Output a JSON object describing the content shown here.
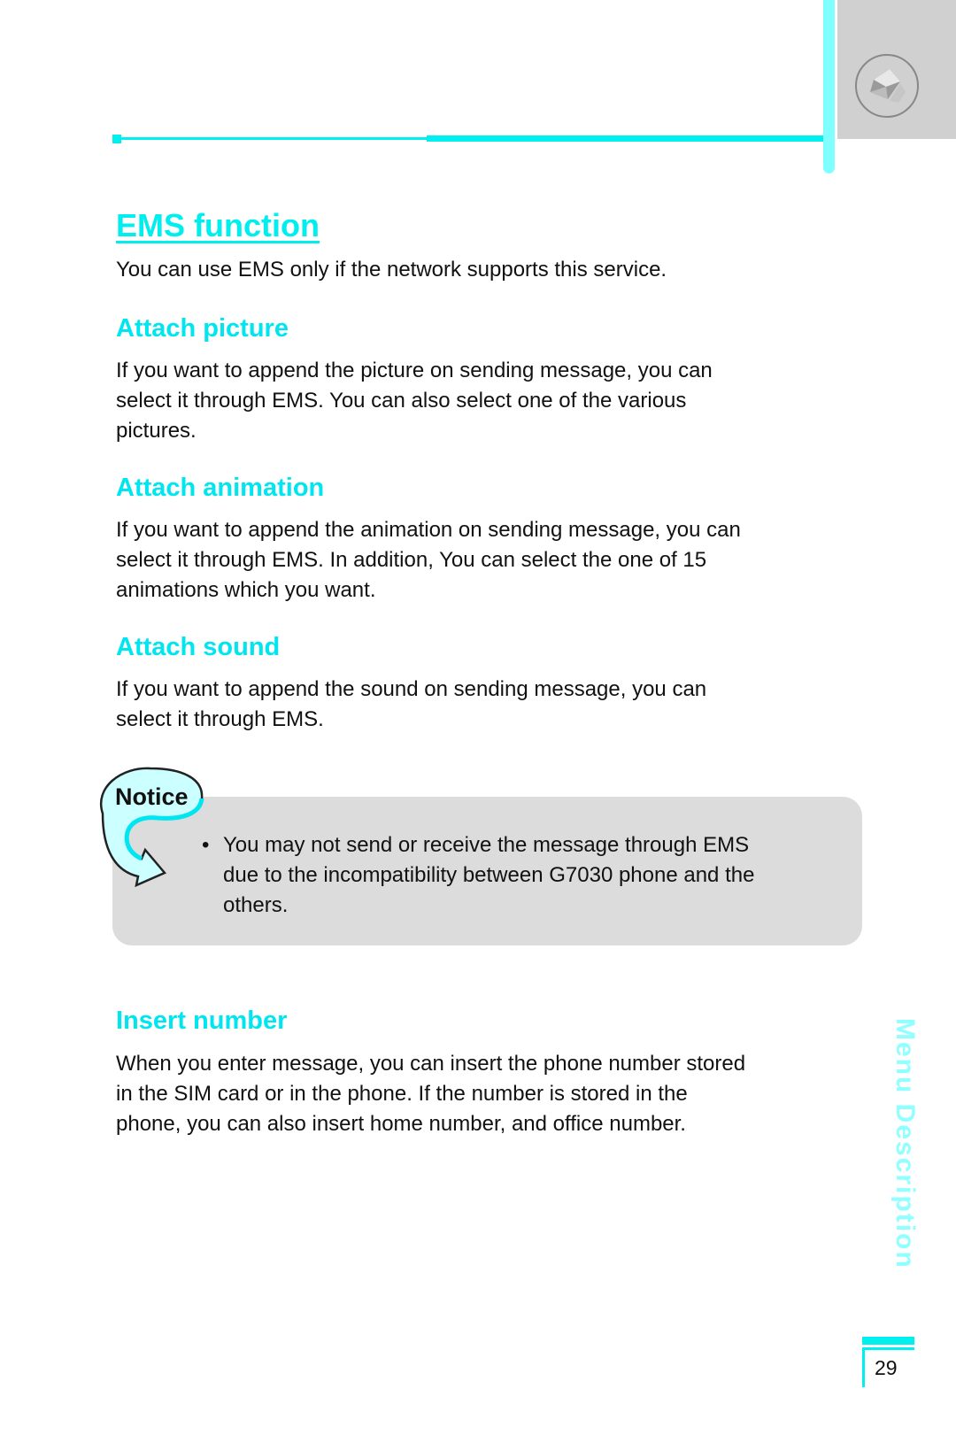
{
  "header": {
    "icon": "envelope-icon"
  },
  "title": "EMS function",
  "intro": "You can use EMS only if the network supports this service.",
  "sections": [
    {
      "heading": "Attach picture",
      "lines": [
        "If you want to append the picture on sending message, you can",
        "select it through EMS. You can also select one of the various",
        "pictures."
      ]
    },
    {
      "heading": "Attach animation",
      "lines": [
        "If you want to append the animation on sending message, you can",
        "select it through EMS. In addition, You can select  the one of 15",
        "animations which you want."
      ]
    },
    {
      "heading": "Attach sound",
      "lines": [
        "If you want to append the sound on sending message, you can",
        "select it through EMS."
      ]
    },
    {
      "heading": "Insert number",
      "lines": [
        "When you enter message, you can insert the phone number stored",
        "in the SIM card or in the phone. If the number is stored in the",
        "phone, you can also insert home number, and office number."
      ]
    }
  ],
  "notice": {
    "label": "Notice",
    "bullet": "•",
    "lines": [
      "You may not send or receive the message through EMS",
      "due to the incompatibility between G7030 phone and the",
      "others."
    ]
  },
  "side_label": "Menu Description",
  "page_number": "29",
  "colors": {
    "accent": "#00F0F0",
    "heading": "#00E6F0",
    "notice_bg": "#DCDCDC"
  }
}
